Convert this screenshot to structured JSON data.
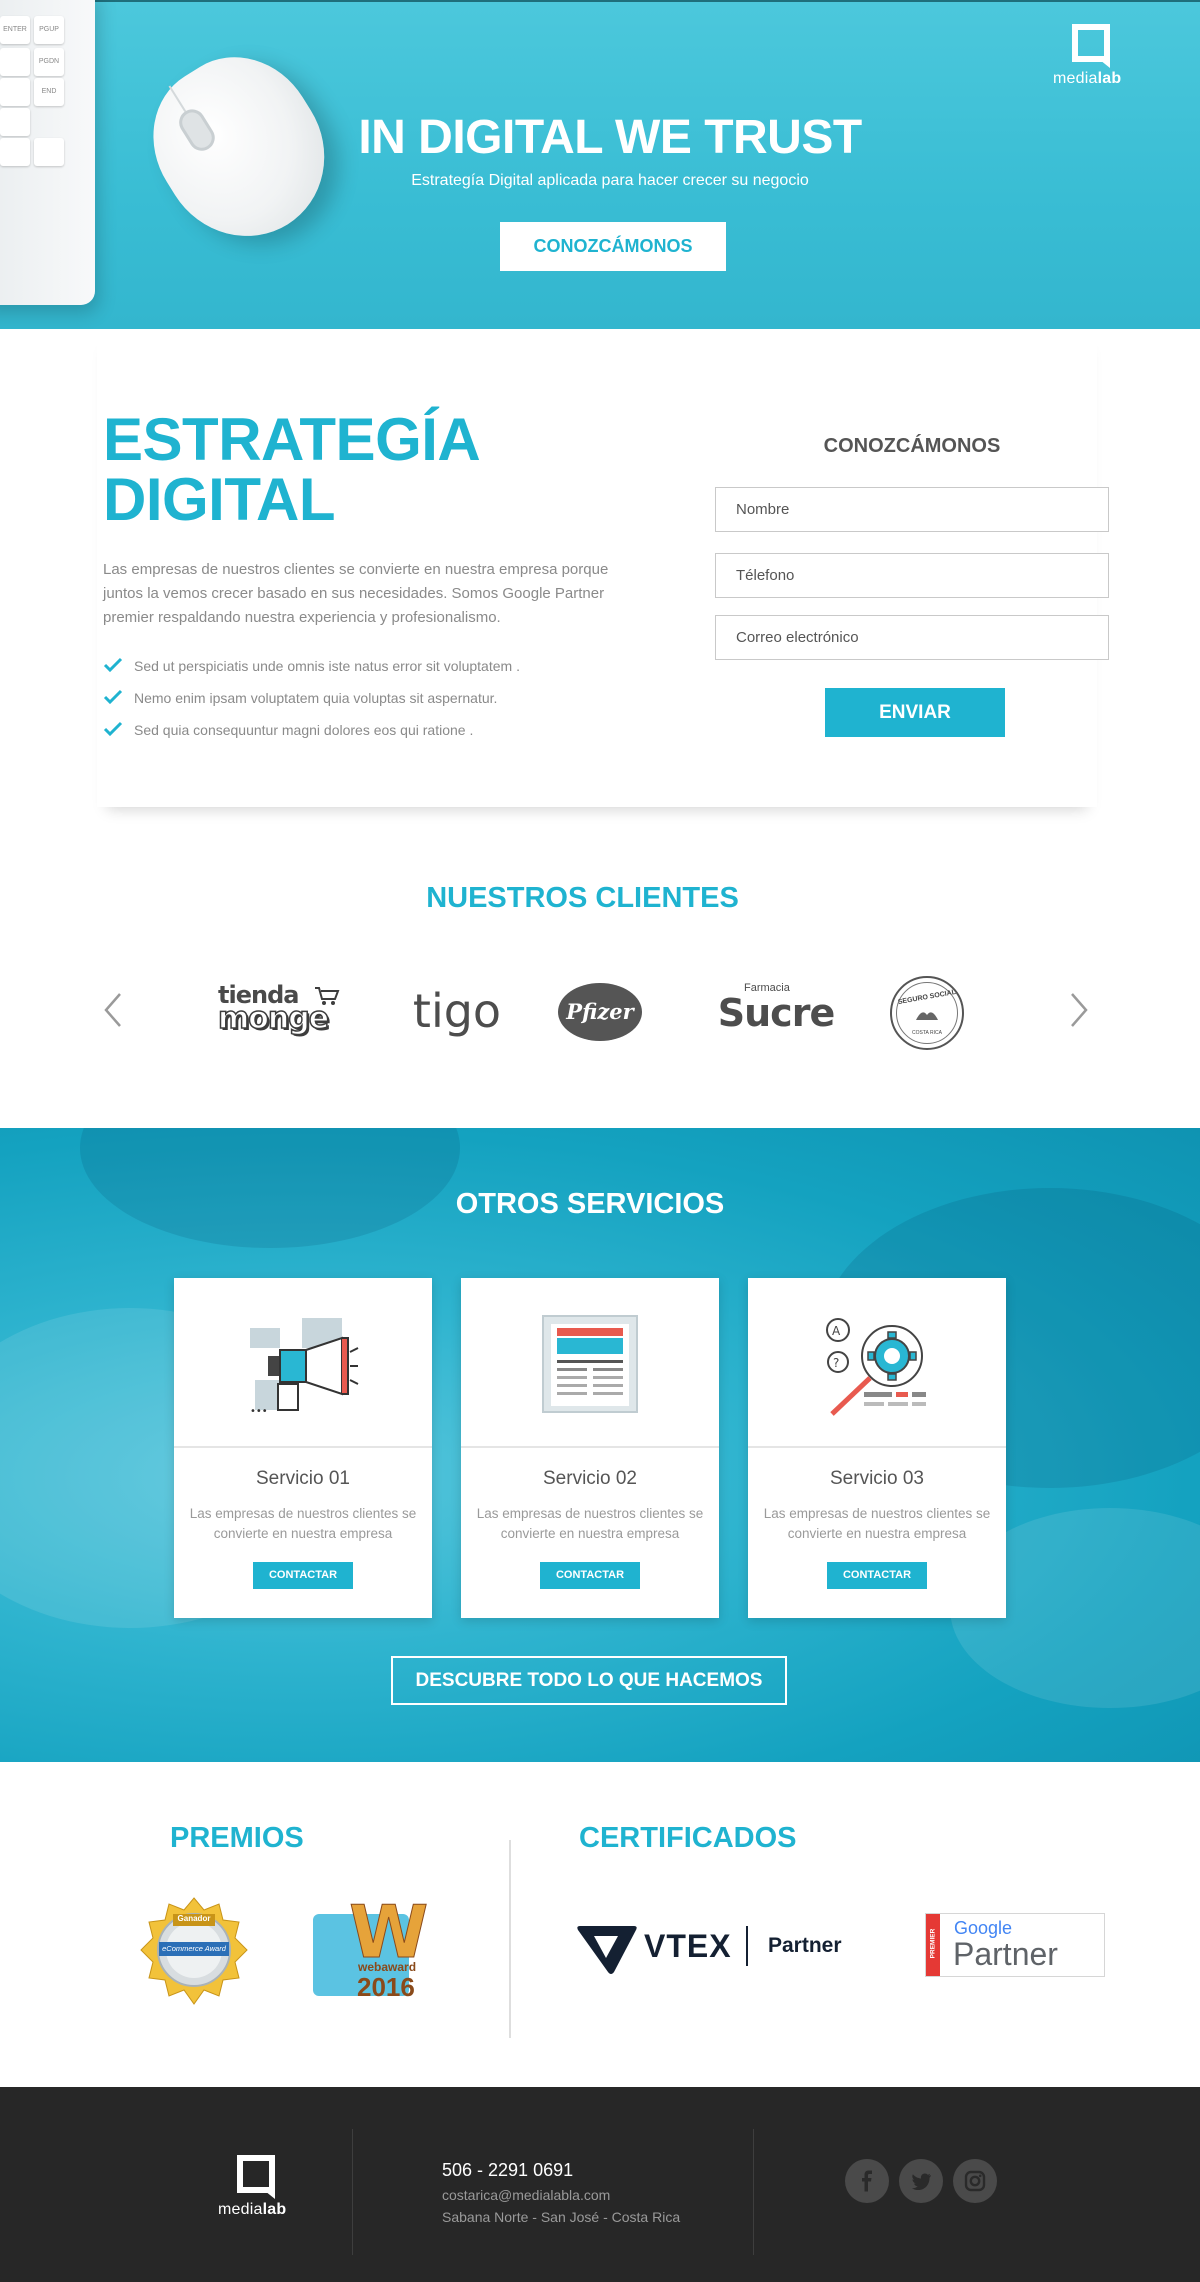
{
  "brand": {
    "logo_name": "media",
    "logo_bold": "lab"
  },
  "hero": {
    "title": "IN DIGITAL WE TRUST",
    "subtitle": "Estrategía Digital aplicada para hacer crecer su negocio",
    "cta_label": "CONOZCÁMONOS",
    "keyboard_keys": [
      "ENTER",
      "PGUP",
      "PGDN",
      "END"
    ]
  },
  "strategy": {
    "title_line1": "ESTRATEGÍA",
    "title_line2": "DIGITAL",
    "paragraph": "Las empresas de nuestros clientes se convierte en nuestra empresa porque juntos la vemos crecer basado en sus necesidades. Somos Google Partner premier respaldando nuestra experiencia y profesionalismo.",
    "checklist": [
      "Sed ut perspiciatis unde omnis iste natus error sit voluptatem .",
      "Nemo enim ipsam voluptatem quia voluptas sit aspernatur.",
      "Sed quia consequuntur magni dolores eos qui ratione ."
    ]
  },
  "contact_form": {
    "title": "CONOZCÁMONOS",
    "name_placeholder": "Nombre",
    "phone_placeholder": "Télefono",
    "email_placeholder": "Correo electrónico",
    "submit_label": "ENVIAR"
  },
  "clients": {
    "title": "NUESTROS CLIENTES",
    "logos": {
      "tienda_line1": "tienda",
      "tienda_line2": "monge",
      "tigo": "tigo",
      "pfizer": "Pfizer",
      "sucre_small": "Farmacia",
      "sucre": "Sucre",
      "seguro": "SEGURO SOCIAL",
      "seguro_small": "COSTA RICA"
    }
  },
  "services": {
    "title": "OTROS SERVICIOS",
    "items": [
      {
        "name": "Servicio 01",
        "desc": "Las empresas de nuestros clientes se convierte en nuestra empresa",
        "button": "CONTACTAR"
      },
      {
        "name": "Servicio 02",
        "desc": "Las empresas de nuestros clientes se convierte en nuestra empresa",
        "button": "CONTACTAR"
      },
      {
        "name": "Servicio 03",
        "desc": "Las empresas de nuestros clientes se convierte en nuestra empresa",
        "button": "CONTACTAR"
      }
    ],
    "cta_label": "DESCUBRE TODO LO QUE HACEMOS"
  },
  "awards": {
    "title": "PREMIOS",
    "ecommerce_badge": {
      "top": "Ganador",
      "label": "eCommerce Award"
    },
    "webaward": {
      "letter": "W",
      "name": "webaward",
      "year": "2016"
    }
  },
  "certificates": {
    "title": "CERTIFICADOS",
    "vtex": {
      "name": "VTEX",
      "partner": "Partner"
    },
    "google": {
      "premier": "PREMIER",
      "google": "Google",
      "partner": "Partner"
    }
  },
  "footer": {
    "phone": "506 - 2291 0691",
    "email": "costarica@medialabla.com",
    "address": "Sabana Norte - San José - Costa Rica",
    "social": [
      "facebook-icon",
      "twitter-icon",
      "instagram-icon"
    ]
  },
  "colors": {
    "accent": "#1fb3d0",
    "footer_bg": "#272727",
    "text_gray": "#8a8a8a"
  }
}
